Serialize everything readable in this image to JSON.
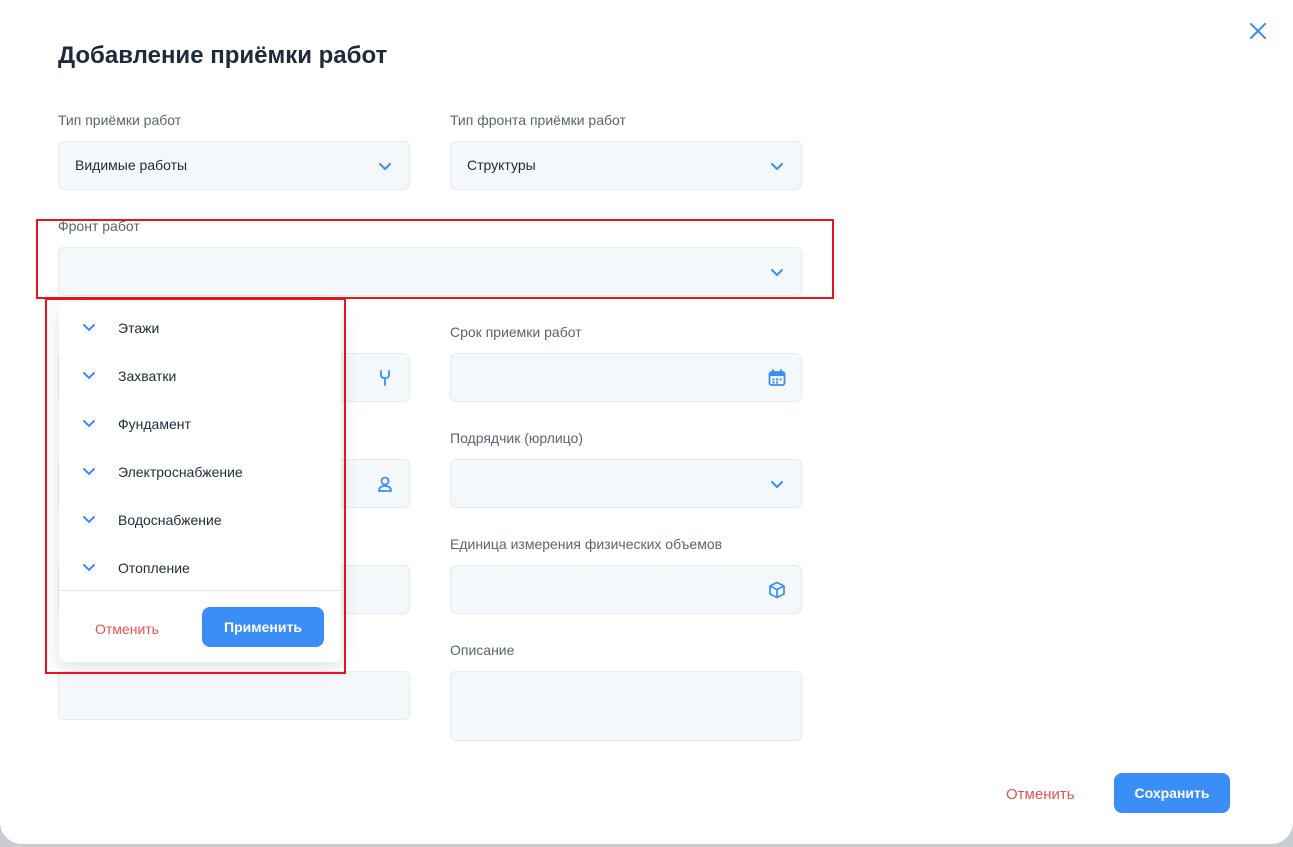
{
  "modal": {
    "title": "Добавление приёмки работ"
  },
  "fields": {
    "work_type": {
      "label": "Тип приёмки работ",
      "value": "Видимые работы"
    },
    "front_type": {
      "label": "Тип фронта приёмки работ",
      "value": "Структуры"
    },
    "work_front": {
      "label": "Фронт работ",
      "value": ""
    },
    "deadline": {
      "label": "Срок приемки работ",
      "value": ""
    },
    "contractor": {
      "label": "Подрядчик (юрлицо)",
      "value": ""
    },
    "unit": {
      "label": "Единица измерения физических объемов",
      "value": ""
    },
    "description": {
      "label": "Описание",
      "value": ""
    }
  },
  "dropdown": {
    "items": [
      {
        "label": "Этажи"
      },
      {
        "label": "Захватки"
      },
      {
        "label": "Фундамент"
      },
      {
        "label": "Электроснабжение"
      },
      {
        "label": "Водоснабжение"
      },
      {
        "label": "Отопление"
      }
    ],
    "cancel_label": "Отменить",
    "apply_label": "Применить"
  },
  "footer": {
    "cancel_label": "Отменить",
    "save_label": "Сохранить"
  },
  "icons": {
    "close": "close-icon",
    "chevron": "chevron-down-icon",
    "wrench": "wrench-icon",
    "calendar": "calendar-icon",
    "user": "user-icon",
    "cube": "cube-icon"
  },
  "colors": {
    "accent": "#3a8ef6",
    "danger": "#e85050",
    "field_bg": "#f5f8fb",
    "title": "#1f2a3c",
    "highlight": "#e8141c"
  }
}
